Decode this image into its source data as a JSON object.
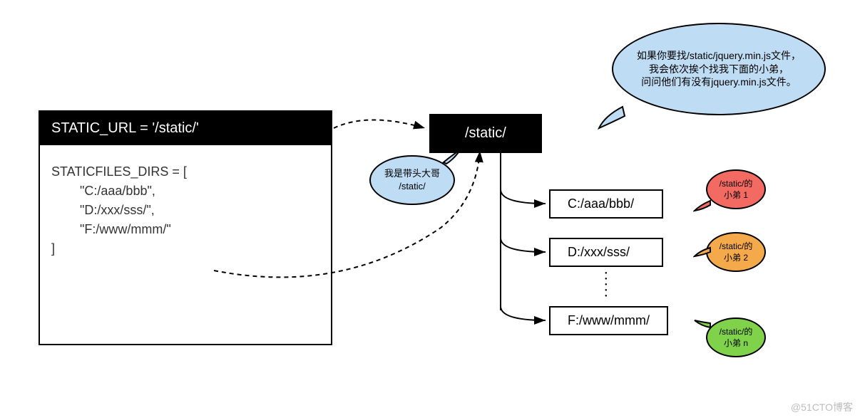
{
  "code": {
    "header": "STATIC_URL = '/static/'",
    "body": "STATICFILES_DIRS = [\n        \"C:/aaa/bbb\",\n        \"D:/xxx/sss/\",\n        \"F:/www/mmm/\"\n]"
  },
  "boss": {
    "label": "/static/"
  },
  "dirs": [
    {
      "path": "C:/aaa/bbb/"
    },
    {
      "path": "D:/xxx/sss/"
    },
    {
      "path": "F:/www/mmm/"
    }
  ],
  "speech": {
    "big": "如果你要找/static/jquery.min.js文件，\n我会依次挨个找我下面的小弟，\n问问他们有没有jquery.min.js文件。",
    "leader": "我是带头大哥\n/static/",
    "minion1": "/static/的\n小弟 1",
    "minion2": "/static/的\n小弟 2",
    "minionN": "/static/的\n小弟 n"
  },
  "watermark": "@51CTO博客"
}
